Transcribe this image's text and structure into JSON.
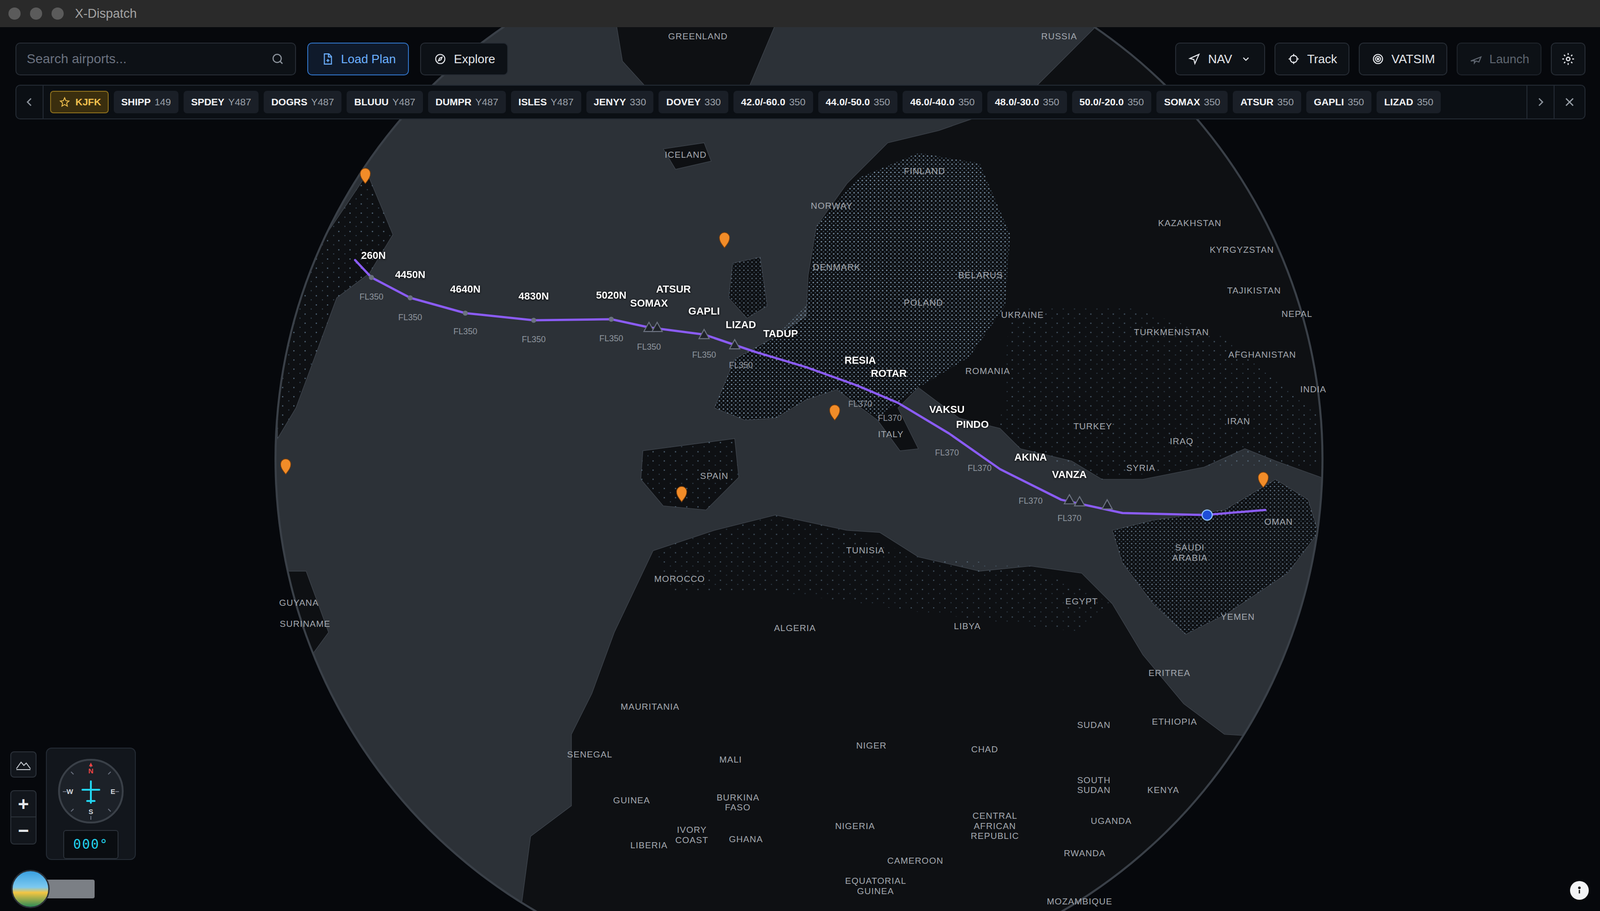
{
  "window": {
    "title": "X-Dispatch"
  },
  "toolbar": {
    "search": {
      "placeholder": "Search airports..."
    },
    "left_buttons": [
      {
        "label": "Load Plan",
        "selected": true
      },
      {
        "label": "Explore",
        "selected": false
      }
    ],
    "right_buttons": [
      {
        "label": "NAV",
        "disabled": false,
        "kind": "dropdown"
      },
      {
        "label": "Track",
        "disabled": false,
        "kind": "button"
      },
      {
        "label": "VATSIM",
        "disabled": false,
        "kind": "button"
      },
      {
        "label": "Launch",
        "disabled": true,
        "kind": "button"
      }
    ]
  },
  "route": {
    "waypoints": [
      {
        "name": "KJFK",
        "selected": true
      },
      {
        "name": "SHIPP",
        "detail": "149",
        "selected": false
      },
      {
        "name": "SPDEY",
        "detail": "Y487",
        "selected": false
      },
      {
        "name": "DOGRS",
        "detail": "Y487",
        "selected": false
      },
      {
        "name": "BLUUU",
        "detail": "Y487",
        "selected": false
      },
      {
        "name": "DUMPR",
        "detail": "Y487",
        "selected": false
      },
      {
        "name": "ISLES",
        "detail": "Y487",
        "selected": false
      },
      {
        "name": "JENYY",
        "detail": "330",
        "selected": false
      },
      {
        "name": "DOVEY",
        "detail": "330",
        "selected": false
      },
      {
        "name": "42.0/-60.0",
        "detail": "350",
        "selected": false
      },
      {
        "name": "44.0/-50.0",
        "detail": "350",
        "selected": false
      },
      {
        "name": "46.0/-40.0",
        "detail": "350",
        "selected": false
      },
      {
        "name": "48.0/-30.0",
        "detail": "350",
        "selected": false
      },
      {
        "name": "50.0/-20.0",
        "detail": "350",
        "selected": false
      },
      {
        "name": "SOMAX",
        "detail": "350",
        "selected": false
      },
      {
        "name": "ATSUR",
        "detail": "350",
        "selected": false
      },
      {
        "name": "GAPLI",
        "detail": "350",
        "selected": false
      },
      {
        "name": "LIZAD",
        "detail": "350",
        "selected": false
      }
    ]
  },
  "map": {
    "waypoints": [
      {
        "name": "260N",
        "level": "FL350"
      },
      {
        "name": "4450N",
        "level": "FL350"
      },
      {
        "name": "4640N",
        "level": "FL350"
      },
      {
        "name": "4830N",
        "level": "FL350"
      },
      {
        "name": "5020N",
        "level": "FL350"
      },
      {
        "name": "SOMAX",
        "level": "FL350"
      },
      {
        "name": "ATSUR"
      },
      {
        "name": "GAPLI",
        "level": "FL350"
      },
      {
        "name": "LIZAD",
        "level": "FL350"
      },
      {
        "name": "TADUP"
      },
      {
        "name": "RESIA",
        "level": "FL370"
      },
      {
        "name": "ROTAR",
        "level": "FL370"
      },
      {
        "name": "VAKSU",
        "level": "FL370"
      },
      {
        "name": "PINDO",
        "level": "FL370"
      },
      {
        "name": "AKINA",
        "level": "FL370"
      },
      {
        "name": "VANZA",
        "level": "FL370"
      }
    ],
    "countries": [
      "GREENLAND",
      "RUSSIA",
      "ICELAND",
      "FINLAND",
      "NORWAY",
      "DENMARK",
      "BELARUS",
      "POLAND",
      "UKRAINE",
      "ROMANIA",
      "KAZAKHSTAN",
      "KYRGYZSTAN",
      "TAJIKISTAN",
      "TURKMENISTAN",
      "AFGHANISTAN",
      "NEPAL",
      "INDIA",
      "IRAN",
      "IRAQ",
      "TURKEY",
      "SYRIA",
      "SPAIN",
      "ITALY",
      "MOROCCO",
      "TUNISIA",
      "ALGERIA",
      "LIBYA",
      "EGYPT",
      "SAUDI ARABIA",
      "OMAN",
      "YEMEN",
      "ERITREA",
      "ETHIOPIA",
      "SUDAN",
      "SOUTH SUDAN",
      "CHAD",
      "NIGER",
      "MALI",
      "MAURITANIA",
      "SENEGAL",
      "GUINEA",
      "BURKINA FASO",
      "IVORY COAST",
      "GHANA",
      "LIBERIA",
      "NIGERIA",
      "CAMEROON",
      "CENTRAL AFRICAN REPUBLIC",
      "EQUATORIAL GUINEA",
      "KENYA",
      "UGANDA",
      "RWANDA",
      "MOZAMBIQUE",
      "GUYANA",
      "SURINAME"
    ]
  },
  "controls": {
    "zoom_in": "+",
    "zoom_out": "−",
    "compass": [
      "N",
      "E",
      "S",
      "W"
    ],
    "heading": "000°"
  }
}
